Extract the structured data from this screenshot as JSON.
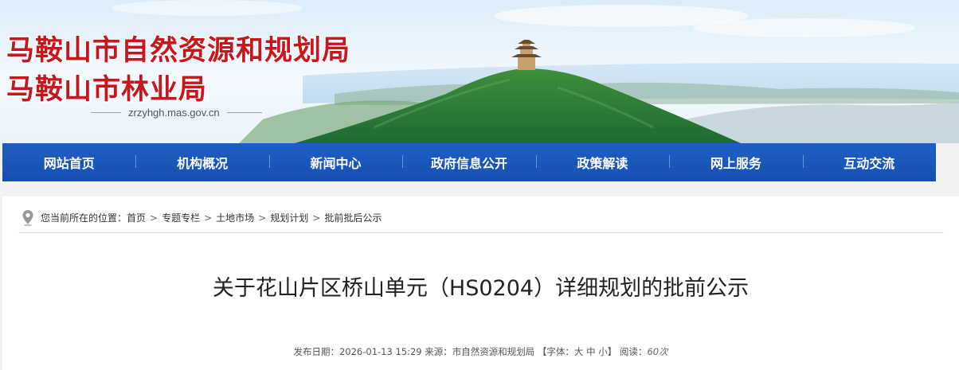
{
  "header": {
    "org_name_line1": "马鞍山市自然资源和规划局",
    "org_name_line2": "马鞍山市林业局",
    "domain": "zrzyhgh.mas.gov.cn"
  },
  "nav": {
    "items": [
      "网站首页",
      "机构概况",
      "新闻中心",
      "政府信息公开",
      "政策解读",
      "网上服务",
      "互动交流"
    ]
  },
  "breadcrumb": {
    "prefix": "您当前所在的位置：",
    "items": [
      "首页",
      "专题专栏",
      "土地市场",
      "规划计划",
      "批前批后公示"
    ],
    "separator": ">"
  },
  "article": {
    "title": "关于花山片区桥山单元（HS0204）详细规划的批前公示",
    "meta": {
      "date_label": "发布日期：",
      "date": "2026-01-13 15:29",
      "source_label": "来源：",
      "source": "市自然资源和规划局",
      "font_label": "【字体：",
      "font_large": "大",
      "font_medium": "中",
      "font_small": "小",
      "font_close": "】",
      "views_label": "阅读：",
      "views": "60次"
    }
  },
  "colors": {
    "brand_red": "#c8161d",
    "nav_blue": "#1a55b8"
  }
}
